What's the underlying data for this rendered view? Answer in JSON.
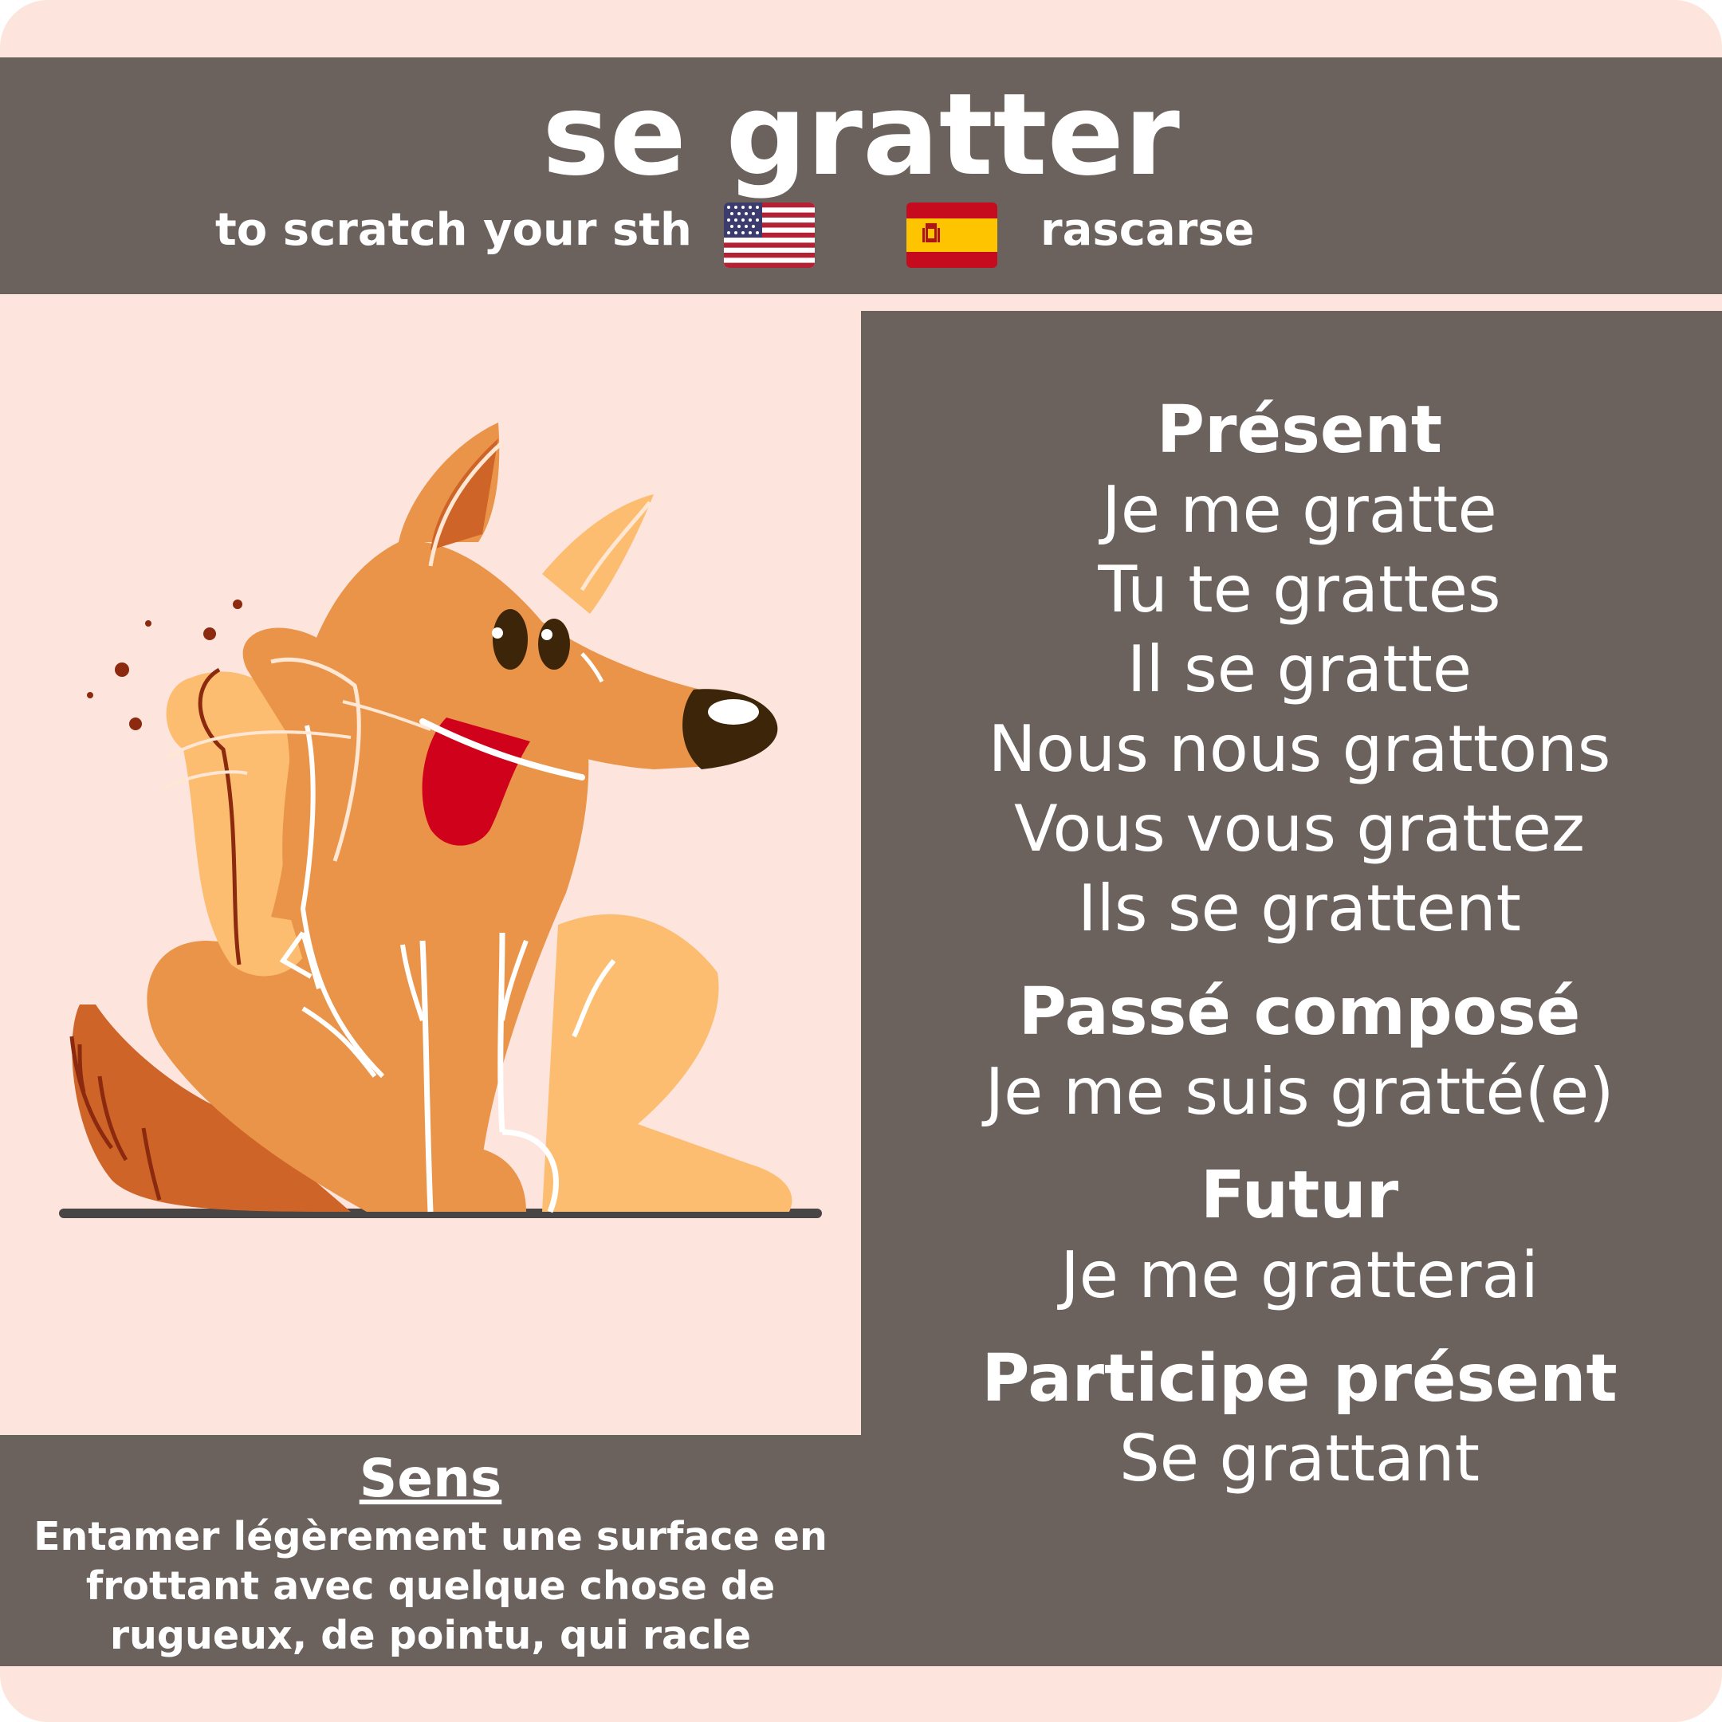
{
  "verb": "se gratter",
  "translations": {
    "en": "to scratch your sth",
    "es": "rascarse",
    "en_flag_icon": "us-flag-icon",
    "es_flag_icon": "spain-flag-icon"
  },
  "illustration_icon": "scratching-dog-icon",
  "conjugation": {
    "present": {
      "heading": "Présent",
      "forms": [
        "Je me gratte",
        "Tu te grattes",
        "Il se gratte",
        "Nous nous grattons",
        "Vous vous grattez",
        "Ils se grattent"
      ]
    },
    "passe_compose": {
      "heading": "Passé composé",
      "form": "Je me suis gratté(e)"
    },
    "futur": {
      "heading": "Futur",
      "form": "Je me gratterai"
    },
    "participe_present": {
      "heading": "Participe présent",
      "form": "Se grattant"
    }
  },
  "sens": {
    "title": "Sens",
    "definition": "Entamer légèrement une surface en frottant avec quelque chose de rugueux, de pointu, qui racle"
  },
  "colors": {
    "background": "#fde4dd",
    "panel": "#6b615d",
    "text": "#ffffff"
  }
}
